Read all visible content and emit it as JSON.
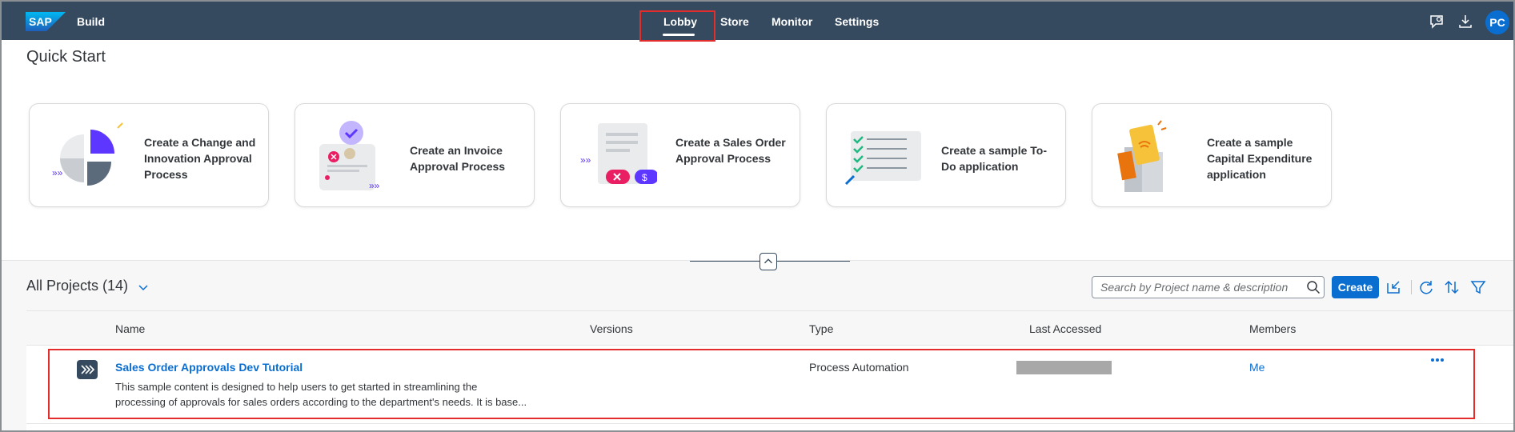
{
  "shell": {
    "logo": "SAP",
    "product": "Build",
    "nav": [
      "Lobby",
      "Store",
      "Monitor",
      "Settings"
    ],
    "active_nav": "Lobby",
    "icons": [
      "feedback-icon",
      "download-icon"
    ],
    "avatar": "PC"
  },
  "quick_start": {
    "title": "Quick Start",
    "cards": [
      {
        "label": "Create a Change and Innovation Approval Process",
        "icon": "pie-chart-icon"
      },
      {
        "label": "Create an Invoice Approval Process",
        "icon": "invoice-icon"
      },
      {
        "label": "Create a Sales Order Approval Process",
        "icon": "sales-order-icon"
      },
      {
        "label": "Create a sample To-Do application",
        "icon": "checklist-icon"
      },
      {
        "label": "Create a sample Capital Expenditure application",
        "icon": "capex-icon"
      }
    ]
  },
  "projects": {
    "title": "All Projects (14)",
    "search_placeholder": "Search by Project name & description",
    "create_label": "Create",
    "columns": [
      "Name",
      "Versions",
      "Type",
      "Last Accessed",
      "Members"
    ],
    "rows": [
      {
        "name": "Sales Order Approvals Dev Tutorial",
        "description_line1": "This sample content is designed to help users to get started in streamlining the",
        "description_line2": "processing of approvals for sales orders according to the department's needs. It is base...",
        "type": "Process Automation",
        "members": "Me"
      }
    ]
  },
  "colors": {
    "shell": "#354a5f",
    "accent": "#0a6ed1",
    "highlight": "#e32d2d"
  }
}
